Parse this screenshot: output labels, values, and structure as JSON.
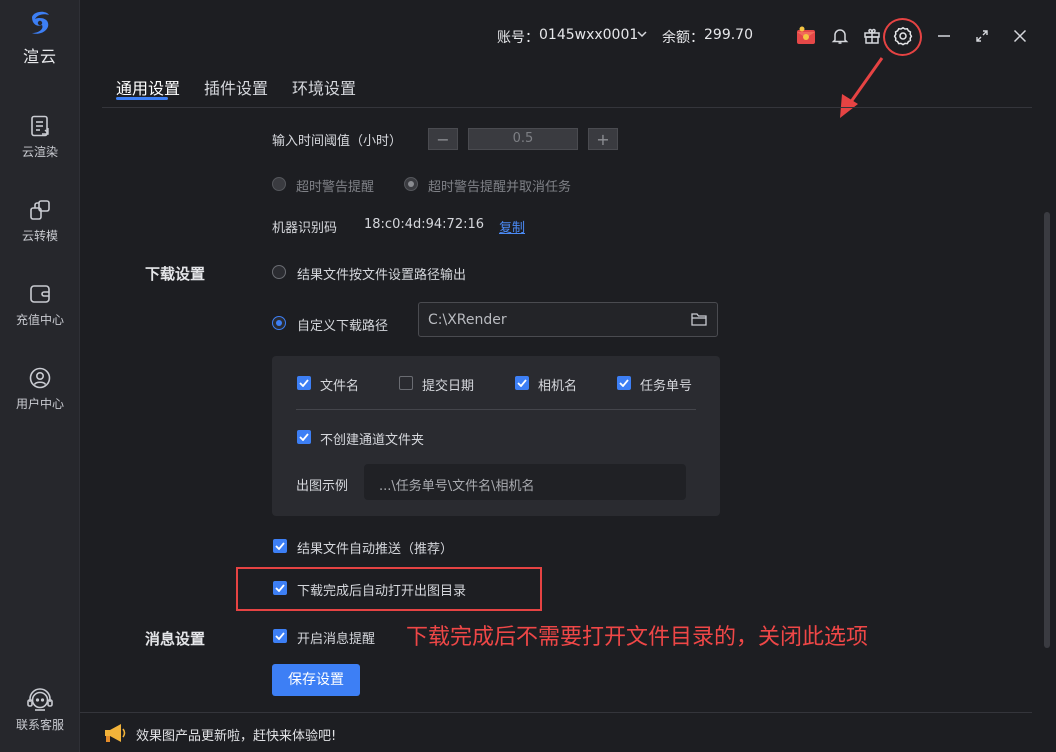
{
  "sidebar": {
    "brand": "渲云",
    "items": [
      {
        "label": "云渲染",
        "icon": "document-icon"
      },
      {
        "label": "云转模",
        "icon": "convert-icon"
      },
      {
        "label": "充值中心",
        "icon": "wallet-icon"
      },
      {
        "label": "用户中心",
        "icon": "user-icon"
      }
    ],
    "support": "联系客服"
  },
  "topbar": {
    "account_label": "账号：",
    "account_value": "0145wxx0001",
    "balance_label": "余额：",
    "balance_value": "299.70"
  },
  "tabs": [
    {
      "label": "通用设置",
      "active": true
    },
    {
      "label": "插件设置",
      "active": false
    },
    {
      "label": "环境设置",
      "active": false
    }
  ],
  "general": {
    "threshold_label": "输入时间阈值（小时）",
    "threshold_minus": "−",
    "threshold_value": "0.5",
    "threshold_plus": "+",
    "timeout_warn": "超时警告提醒",
    "timeout_warn_cancel": "超时警告提醒并取消任务",
    "machine_code_label": "机器识别码",
    "machine_code_value": "18:c0:4d:94:72:16",
    "copy_link": "复制"
  },
  "download": {
    "section_title": "下载设置",
    "option_by_file": "结果文件按文件设置路径输出",
    "option_custom": "自定义下载路径",
    "custom_path": "C:\\XRender",
    "checkboxes": [
      {
        "label": "文件名",
        "checked": true
      },
      {
        "label": "提交日期",
        "checked": false
      },
      {
        "label": "相机名",
        "checked": true
      },
      {
        "label": "任务单号",
        "checked": true
      }
    ],
    "no_channel_folder": "不创建通道文件夹",
    "example_label": "出图示例",
    "example_value": "...\\任务单号\\文件名\\相机名",
    "auto_push": "结果文件自动推送（推荐）",
    "auto_open": "下载完成后自动打开出图目录"
  },
  "message": {
    "section_title": "消息设置",
    "enable_notify": "开启消息提醒"
  },
  "save_button": "保存设置",
  "annotation_note": "下载完成后不需要打开文件目录的，关闭此选项",
  "bottom_notice": "效果图产品更新啦，赶快来体验吧!",
  "colors": {
    "accent": "#3d7ff5",
    "annotation": "#e64343",
    "background": "#1d1e22"
  }
}
